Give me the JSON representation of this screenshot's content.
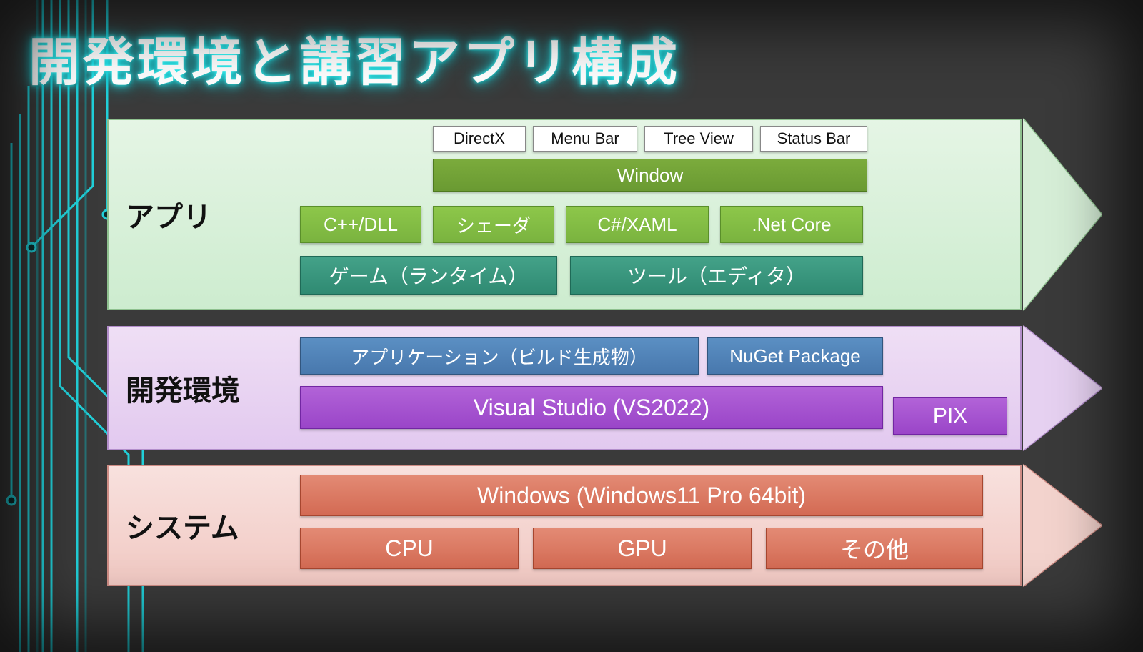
{
  "title": "開発環境と講習アプリ構成",
  "bands": {
    "app": {
      "label": "アプリ"
    },
    "dev": {
      "label": "開発環境"
    },
    "sys": {
      "label": "システム"
    }
  },
  "app": {
    "tabs": [
      "DirectX",
      "Menu Bar",
      "Tree View",
      "Status Bar"
    ],
    "window": "Window",
    "mid": [
      "C++/DLL",
      "シェーダ",
      "C#/XAML",
      ".Net Core"
    ],
    "bottom": [
      "ゲーム（ランタイム）",
      "ツール（エディタ）"
    ]
  },
  "dev": {
    "top": [
      "アプリケーション（ビルド生成物）",
      "NuGet Package"
    ],
    "vs": "Visual Studio (VS2022)",
    "pix": "PIX"
  },
  "sys": {
    "os": "Windows (Windows11 Pro 64bit)",
    "hw": [
      "CPU",
      "GPU",
      "その他"
    ]
  }
}
